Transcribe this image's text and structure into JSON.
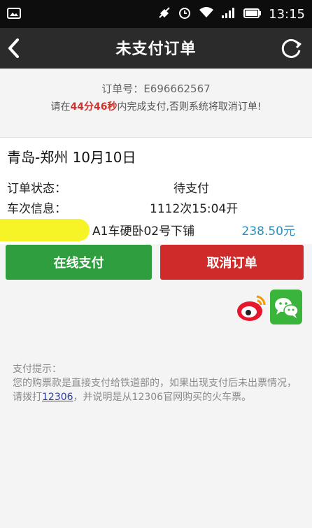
{
  "status_bar": {
    "time": "13:15"
  },
  "header": {
    "title": "未支付订单"
  },
  "order": {
    "number_label": "订单号：",
    "number": "E696662567",
    "countdown_prefix": "请在",
    "countdown_minutes": "44分",
    "countdown_seconds": "46秒",
    "countdown_suffix": "内完成支付,否则系统将取消订单!"
  },
  "trip": {
    "route": "青岛-郑州 10月10日"
  },
  "details": {
    "status_label": "订单状态：",
    "status_value": "待支付",
    "train_label": "车次信息：",
    "train_value": "1112次15:04开",
    "seat": "A1车硬卧02号下铺",
    "price": "238.50元"
  },
  "buttons": {
    "pay": "在线支付",
    "cancel": "取消订单"
  },
  "tips": {
    "title": "支付提示：",
    "text_before": "您的购票款是直接支付给铁道部的，如果出现支付后未出票情况，请拨打",
    "phone": "12306",
    "text_after": "，并说明是从12306官网购买的火车票。"
  },
  "colors": {
    "pay": "#2e9e3e",
    "cancel": "#cf2b2b",
    "countdown": "#d0312d",
    "price": "#2a8fbd",
    "highlight": "#f5f21a"
  }
}
